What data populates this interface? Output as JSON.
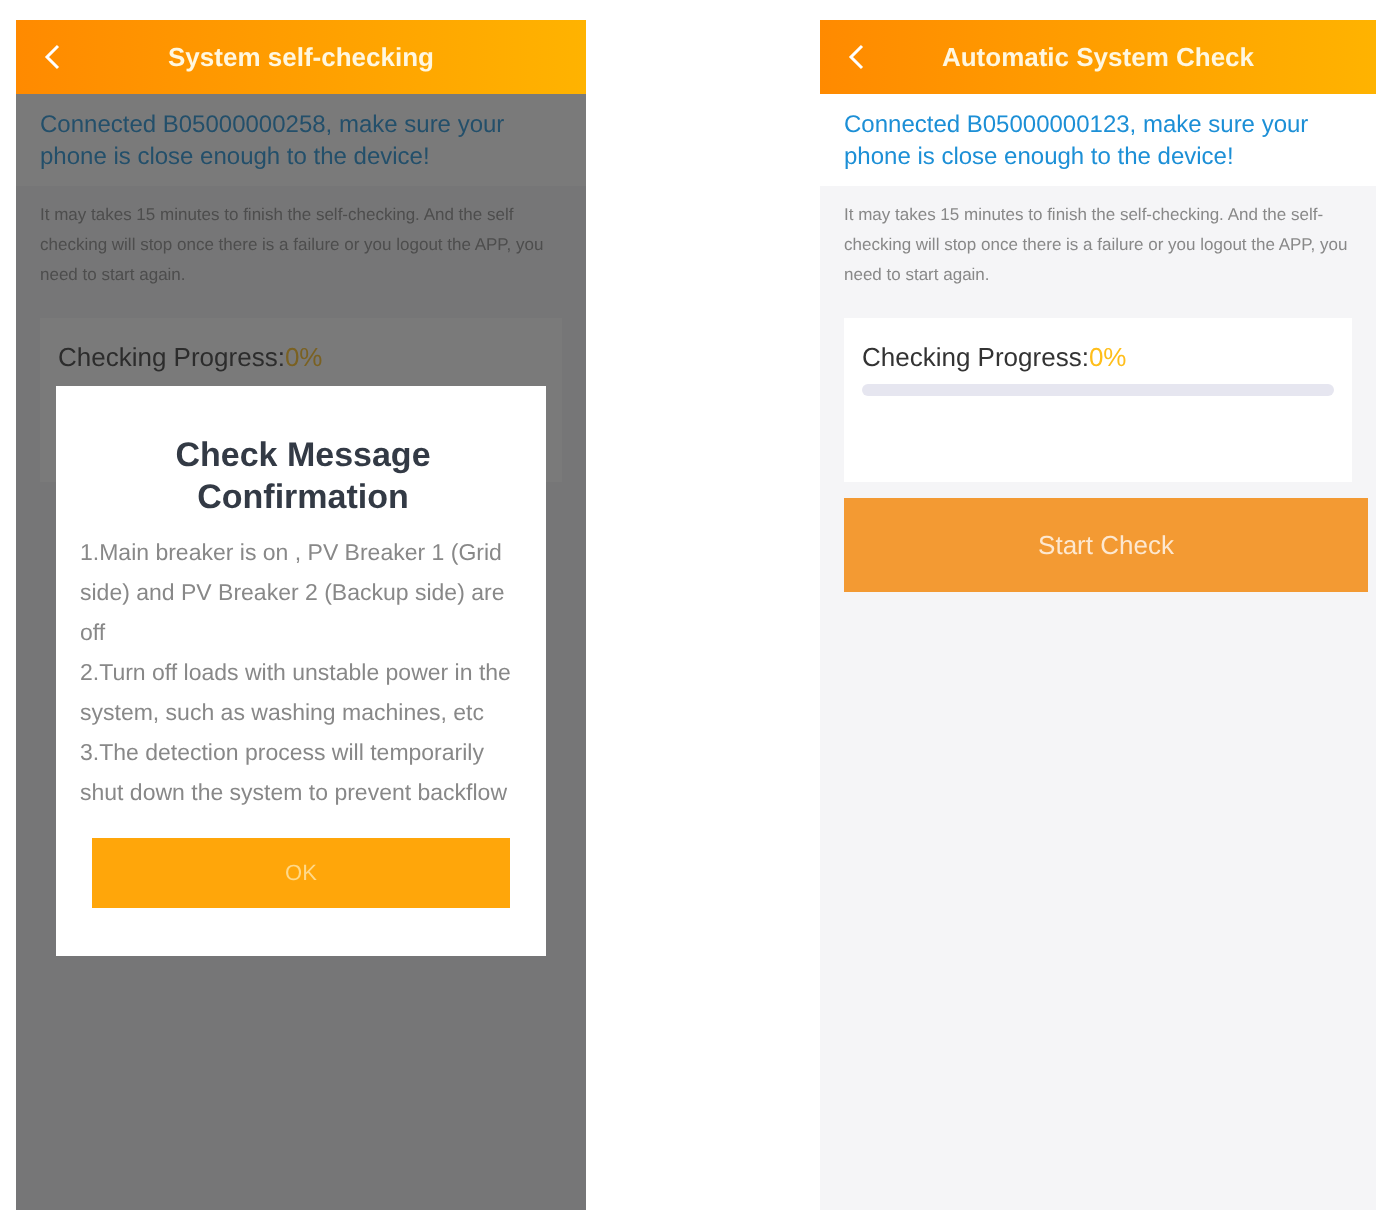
{
  "screens": [
    {
      "header": {
        "title": "System self-checking"
      },
      "connection_message": "Connected B05000000258, make sure your phone is close enough to the device!",
      "info_text": "It may takes 15 minutes to finish the self-checking. And the self checking will stop once there is a failure or you logout the APP, you need to start again.",
      "progress": {
        "label": "Checking Progress:",
        "value": "0%"
      },
      "dialog": {
        "title": "Check Message Confirmation",
        "lines": [
          "1.Main breaker is on , PV Breaker 1 (Grid side) and PV Breaker 2 (Backup side) are off",
          "2.Turn off loads with unstable power in the system, such as washing machines, etc",
          "3.The detection process will temporarily shut down the system to prevent backflow"
        ],
        "button": "OK"
      }
    },
    {
      "header": {
        "title": "Automatic System Check"
      },
      "connection_message": "Connected B05000000123, make sure your phone is close enough to the device!",
      "info_text": "It may takes 15 minutes to finish the self-checking. And the self-checking will stop once there is a failure or you logout the APP, you need to start again.",
      "progress": {
        "label": "Checking Progress:",
        "value": "0%",
        "level": 0
      },
      "start_button": "Start Check"
    }
  ]
}
